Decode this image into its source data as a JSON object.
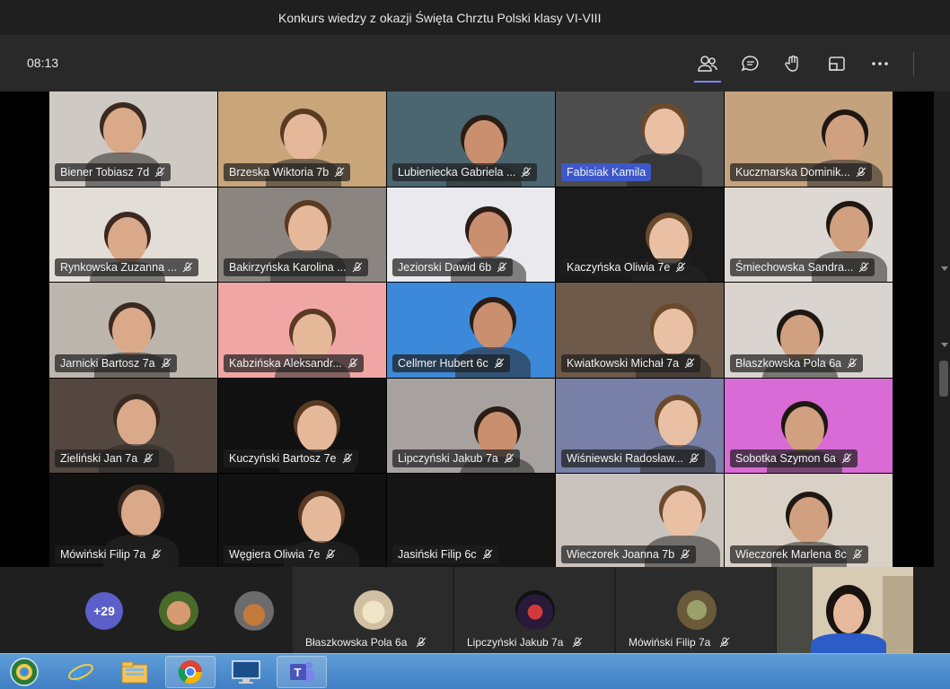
{
  "window": {
    "title": "Konkurs wiedzy z okazji Święta Chrztu Polski klasy VI-VIII"
  },
  "meeting": {
    "time": "08:13",
    "toolbar": [
      "participants-icon",
      "chat-icon",
      "raise-hand-icon",
      "share-screen-icon",
      "more-options-icon"
    ]
  },
  "grid": [
    {
      "name": "Biener Tobiasz 7d",
      "bg": "#cfc9c4"
    },
    {
      "name": "Brzeska Wiktoria 7b",
      "bg": "#c9a57a"
    },
    {
      "name": "Lubieniecka Gabriela ...",
      "bg": "#4b6670"
    },
    {
      "name": "Fabisiak Kamila",
      "bg": "#4d4d4d",
      "highlight": true
    },
    {
      "name": "Kuczmarska Dominik...",
      "bg": "#c5a27e"
    },
    {
      "name": "Rynkowska Zuzanna ...",
      "bg": "#e3ddd7"
    },
    {
      "name": "Bakirzyńska Karolina ...",
      "bg": "#8a8580"
    },
    {
      "name": "Jeziorski Dawid 6b",
      "bg": "#e9e9ee"
    },
    {
      "name": "Kaczyńska Oliwia 7e",
      "bg": "#1a1a1a"
    },
    {
      "name": "Śmiechowska Sandra...",
      "bg": "#ddd8d3"
    },
    {
      "name": "Jarnicki Bartosz 7a",
      "bg": "#bdb6ae"
    },
    {
      "name": "Kabzińska Aleksandr...",
      "bg": "#f1a6a6"
    },
    {
      "name": "Cellmer Hubert 6c",
      "bg": "#3c88d9"
    },
    {
      "name": "Kwiatkowski Michał 7a",
      "bg": "#6e5a4a"
    },
    {
      "name": "Błaszkowska Pola 6a",
      "bg": "#d9d4cf"
    },
    {
      "name": "Zieliński Jan 7a",
      "bg": "#53473f"
    },
    {
      "name": "Kuczyński Bartosz 7e",
      "bg": "#111111"
    },
    {
      "name": "Lipczyński Jakub 7a",
      "bg": "#a7a2a0"
    },
    {
      "name": "Wiśniewski Radosław...",
      "bg": "#7880a7"
    },
    {
      "name": "Sobotka Szymon 6a",
      "bg": "#d86bd6"
    },
    {
      "name": "Mówiński Filip 7a",
      "bg": "#111111"
    },
    {
      "name": "Węgiera Oliwia 7e",
      "bg": "#111111"
    },
    {
      "name": "Jasiński Filip 6c",
      "bg": "#151515"
    },
    {
      "name": "Wieczorek Joanna 7b",
      "bg": "#cac3bd"
    },
    {
      "name": "Wieczorek Marlena 8c",
      "bg": "#d9d0c6"
    }
  ],
  "strip": {
    "more_count": "+29",
    "cards": [
      {
        "name": "Błaszkowska Pola 6a"
      },
      {
        "name": "Lipczyński Jakub 7a"
      },
      {
        "name": "Mówiński Filip 7a"
      }
    ]
  },
  "taskbar": {
    "apps": [
      "start-orb-icon",
      "internet-explorer-icon",
      "file-explorer-icon",
      "chrome-icon",
      "lenovo-icon",
      "teams-icon"
    ]
  }
}
